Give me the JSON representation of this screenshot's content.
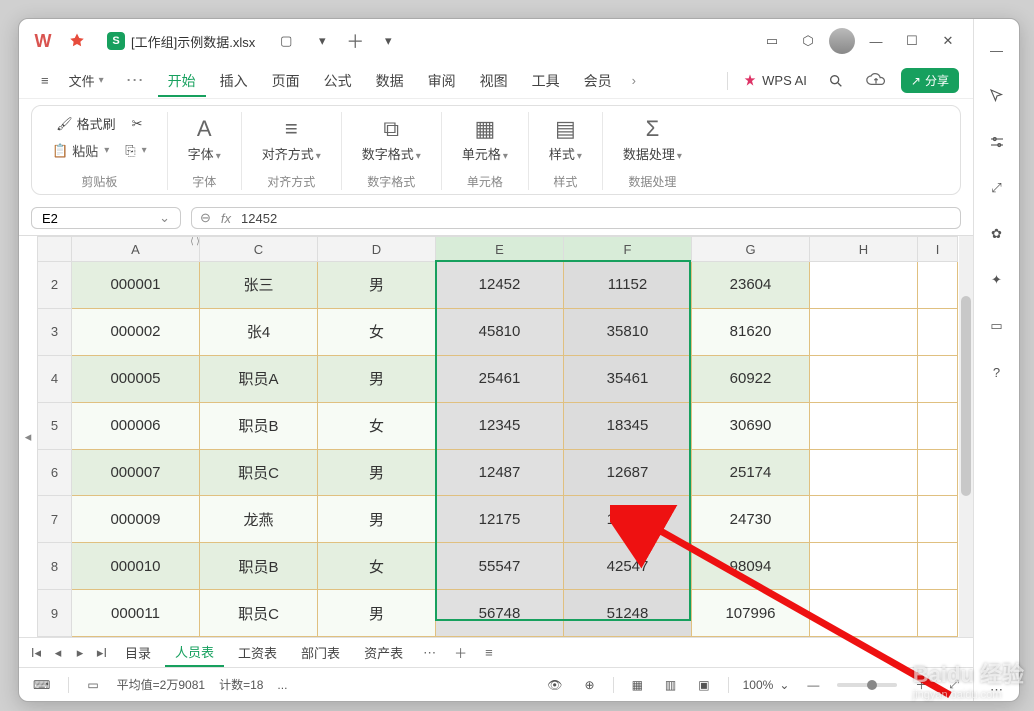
{
  "titlebar": {
    "app_logo": "W",
    "file_tab_icon": "S",
    "file_tab_name": "[工作组]示例数据.xlsx"
  },
  "menubar": {
    "file_label": "文件",
    "items": [
      "开始",
      "插入",
      "页面",
      "公式",
      "数据",
      "审阅",
      "视图",
      "工具",
      "会员"
    ],
    "active_index": 0,
    "wps_ai_label": "WPS AI",
    "share_label": "分享"
  },
  "ribbon": {
    "clipboard": {
      "title": "剪贴板",
      "format_painter": "格式刷",
      "paste": "粘贴"
    },
    "font": {
      "title": "字体",
      "label": "字体"
    },
    "align": {
      "title": "对齐方式",
      "label": "对齐方式"
    },
    "number": {
      "title": "数字格式",
      "label": "数字格式"
    },
    "cell": {
      "title": "单元格",
      "label": "单元格"
    },
    "style": {
      "title": "样式",
      "label": "样式"
    },
    "dataproc": {
      "title": "数据处理",
      "label": "数据处理"
    }
  },
  "formula_bar": {
    "name_box": "E2",
    "fx_label": "fx",
    "value": "12452"
  },
  "grid": {
    "columns": [
      "A",
      "C",
      "D",
      "E",
      "F",
      "G",
      "H",
      "I"
    ],
    "row_start": 2,
    "rows": [
      {
        "A": "000001",
        "C": "张三",
        "D": "男",
        "E": "12452",
        "F": "11152",
        "G": "23604"
      },
      {
        "A": "000002",
        "C": "张4",
        "D": "女",
        "E": "45810",
        "F": "35810",
        "G": "81620"
      },
      {
        "A": "000005",
        "C": "职员A",
        "D": "男",
        "E": "25461",
        "F": "35461",
        "G": "60922"
      },
      {
        "A": "000006",
        "C": "职员B",
        "D": "女",
        "E": "12345",
        "F": "18345",
        "G": "30690"
      },
      {
        "A": "000007",
        "C": "职员C",
        "D": "男",
        "E": "12487",
        "F": "12687",
        "G": "25174"
      },
      {
        "A": "000009",
        "C": "龙燕",
        "D": "男",
        "E": "12175",
        "F": "12555",
        "G": "24730"
      },
      {
        "A": "000010",
        "C": "职员B",
        "D": "女",
        "E": "55547",
        "F": "42547",
        "G": "98094"
      },
      {
        "A": "000011",
        "C": "职员C",
        "D": "男",
        "E": "56748",
        "F": "51248",
        "G": "107996"
      }
    ]
  },
  "sheets": {
    "tabs": [
      "目录",
      "人员表",
      "工资表",
      "部门表",
      "资产表"
    ],
    "active_index": 1
  },
  "statusbar": {
    "avg_label": "平均值=2万9081",
    "count_label": "计数=18",
    "ellipsis": "...",
    "zoom": "100%"
  },
  "watermark": {
    "brand": "Baidu 经验",
    "sub": "jingyan.baidu.com"
  },
  "chart_data": {
    "type": "table",
    "columns": [
      "A",
      "C",
      "D",
      "E",
      "F",
      "G"
    ],
    "rows": [
      [
        "000001",
        "张三",
        "男",
        12452,
        11152,
        23604
      ],
      [
        "000002",
        "张4",
        "女",
        45810,
        35810,
        81620
      ],
      [
        "000005",
        "职员A",
        "男",
        25461,
        35461,
        60922
      ],
      [
        "000006",
        "职员B",
        "女",
        12345,
        18345,
        30690
      ],
      [
        "000007",
        "职员C",
        "男",
        12487,
        12687,
        25174
      ],
      [
        "000009",
        "龙燕",
        "男",
        12175,
        12555,
        24730
      ],
      [
        "000010",
        "职员B",
        "女",
        55547,
        42547,
        98094
      ],
      [
        "000011",
        "职员C",
        "男",
        56748,
        51248,
        107996
      ]
    ],
    "selected_range": "E2:F9",
    "active_cell": "E2"
  }
}
